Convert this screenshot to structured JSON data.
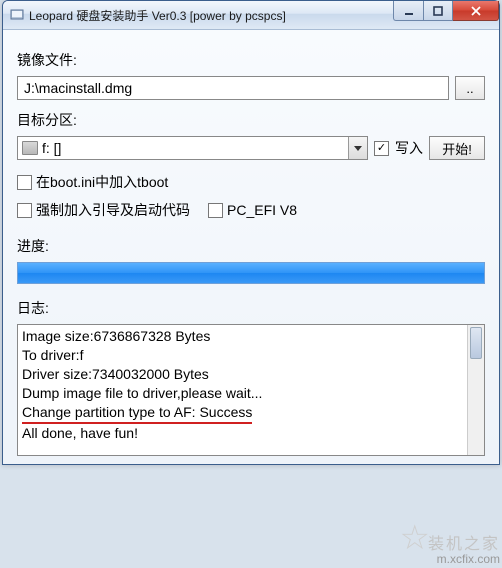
{
  "window": {
    "title": "Leopard 硬盘安装助手 Ver0.3 [power by pcspcs]"
  },
  "image": {
    "label": "镜像文件:",
    "path": "J:\\macinstall.dmg",
    "browse": ".."
  },
  "target": {
    "label": "目标分区:",
    "selected": "f: []",
    "write_label": "写入",
    "start_label": "开始!"
  },
  "options": {
    "tboot": "在boot.ini中加入tboot",
    "force": "强制加入引导及启动代码",
    "pcefi": "PC_EFI V8"
  },
  "progress": {
    "label": "进度:"
  },
  "log": {
    "label": "日志:",
    "lines": {
      "l0": "Image size:6736867328 Bytes",
      "l1": "To driver:f",
      "l2": "Driver size:7340032000 Bytes",
      "l3": "Dump image file to driver,please wait...",
      "l4": "Change partition type to AF: Success",
      "l5": "All done, have fun!"
    }
  },
  "watermark": {
    "brand": "装机之家",
    "url": "m.xcfix.com"
  }
}
